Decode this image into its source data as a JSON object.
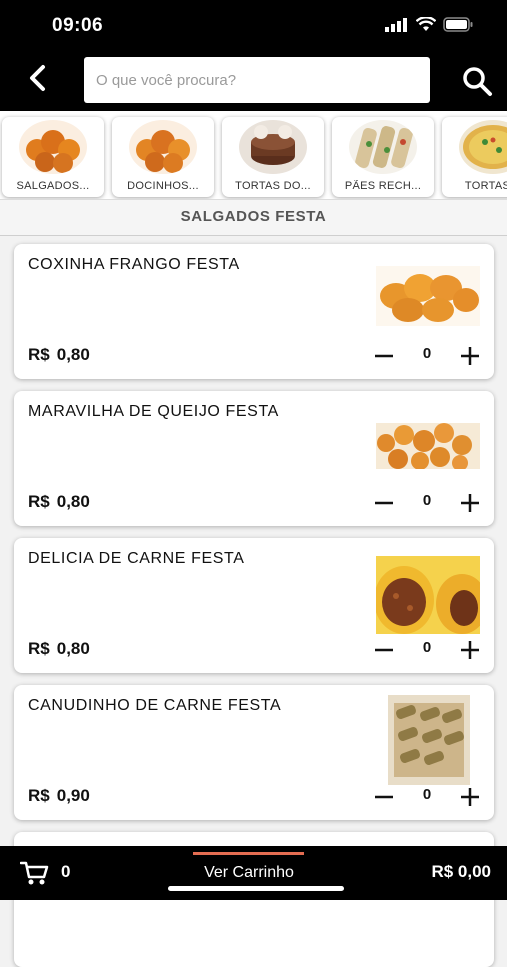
{
  "status_bar": {
    "time": "09:06"
  },
  "header": {
    "search_placeholder": "O que você procura?",
    "colors": {
      "background": "#000000",
      "search_bg": "#ffffff"
    },
    "icons": {
      "back": "chevron-left-icon",
      "search": "search-icon"
    }
  },
  "categories": [
    {
      "label": "SALGADOS...",
      "icon": "coxinha-thumb"
    },
    {
      "label": "DOCINHOS...",
      "icon": "docinhos-thumb"
    },
    {
      "label": "TORTAS DO...",
      "icon": "tortas-doces-thumb"
    },
    {
      "label": "PÃES RECH...",
      "icon": "paes-recheados-thumb"
    },
    {
      "label": "TORTAS S",
      "icon": "tortas-salgadas-thumb"
    }
  ],
  "section_title": "SALGADOS FESTA",
  "products": [
    {
      "name": "COXINHA FRANGO FESTA",
      "currency": "R$",
      "price": "0,80",
      "qty": "0",
      "image": "coxinha-image"
    },
    {
      "name": "MARAVILHA DE QUEIJO FESTA",
      "currency": "R$",
      "price": "0,80",
      "qty": "0",
      "image": "bolinha-queijo-image"
    },
    {
      "name": "DELICIA DE CARNE FESTA",
      "currency": "R$",
      "price": "0,80",
      "qty": "0",
      "image": "delicia-carne-image"
    },
    {
      "name": "CANUDINHO DE CARNE FESTA",
      "currency": "R$",
      "price": "0,90",
      "qty": "0",
      "image": "canudinho-image"
    }
  ],
  "bottom_bar": {
    "cart_count": "0",
    "view_cart_label": "Ver Carrinho",
    "total": "R$ 0,00",
    "accent_color": "#e46d52",
    "icons": {
      "cart": "cart-icon"
    }
  }
}
